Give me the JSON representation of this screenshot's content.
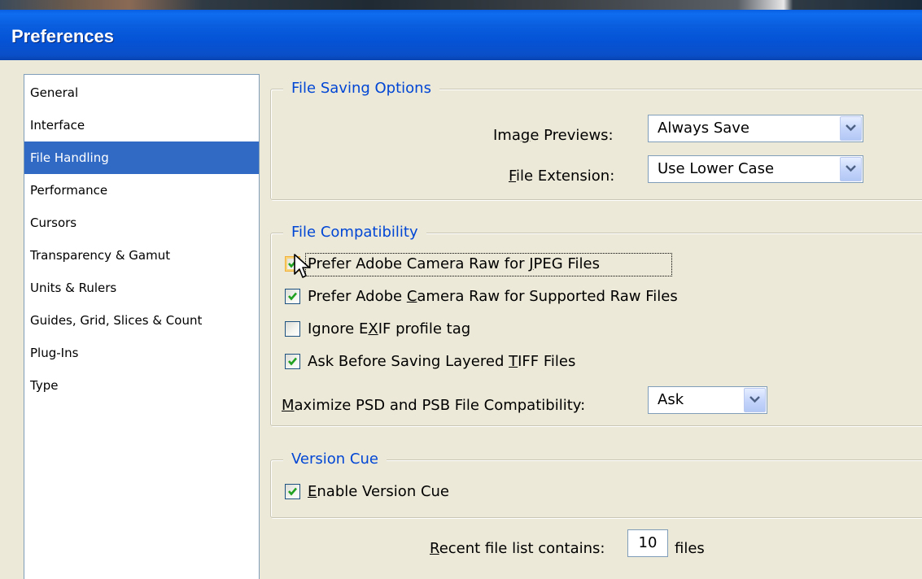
{
  "window": {
    "title": "Preferences"
  },
  "categories": [
    {
      "label": "General",
      "selected": false
    },
    {
      "label": "Interface",
      "selected": false
    },
    {
      "label": "File Handling",
      "selected": true
    },
    {
      "label": "Performance",
      "selected": false
    },
    {
      "label": "Cursors",
      "selected": false
    },
    {
      "label": "Transparency & Gamut",
      "selected": false
    },
    {
      "label": "Units & Rulers",
      "selected": false
    },
    {
      "label": "Guides, Grid, Slices & Count",
      "selected": false
    },
    {
      "label": "Plug-Ins",
      "selected": false
    },
    {
      "label": "Type",
      "selected": false
    }
  ],
  "file_saving": {
    "legend": "File Saving Options",
    "image_previews": {
      "label_pre": "Ima",
      "label_u": "g",
      "label_post": "e Previews:",
      "value": "Always Save"
    },
    "file_extension": {
      "label_pre": "",
      "label_u": "F",
      "label_post": "ile Extension:",
      "value": "Use Lower Case"
    }
  },
  "file_compat": {
    "legend": "File Compatibility",
    "jpeg": {
      "pre": "Prefer Adobe Camera Raw for ",
      "u": "J",
      "post": "PEG Files",
      "checked": true
    },
    "raw": {
      "pre": "Prefer Adobe ",
      "u": "C",
      "post": "amera Raw for Supported Raw Files",
      "checked": true
    },
    "exif": {
      "pre": "Ignore E",
      "u": "X",
      "post": "IF profile tag",
      "checked": false
    },
    "tiff": {
      "pre": "Ask Before Saving Layered ",
      "u": "T",
      "post": "IFF Files",
      "checked": true
    },
    "maximize": {
      "u": "M",
      "post": "aximize PSD and PSB File Compatibility:",
      "value": "Ask"
    }
  },
  "version_cue": {
    "legend": "Version Cue",
    "enable": {
      "u": "E",
      "post": "nable Version Cue",
      "checked": true
    }
  },
  "recent": {
    "u": "R",
    "post": "ecent file list contains:",
    "value": "10",
    "suffix": "files"
  }
}
